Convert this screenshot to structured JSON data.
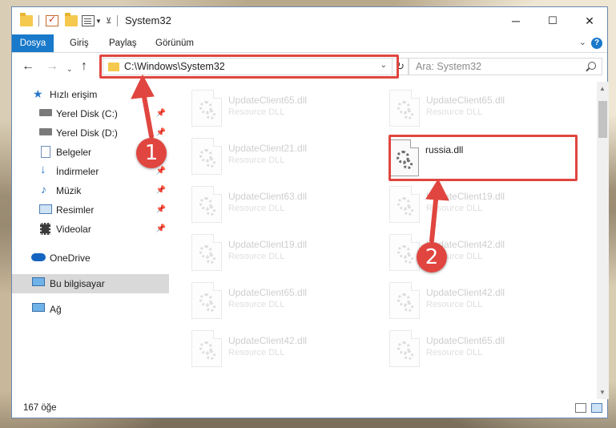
{
  "window": {
    "title": "System32",
    "controls": {
      "minimize": "─",
      "maximize": "☐",
      "close": "✕"
    }
  },
  "ribbon": {
    "tabs": [
      "Dosya",
      "Giriş",
      "Paylaş",
      "Görünüm"
    ],
    "help": "?"
  },
  "navbar": {
    "address": "C:\\Windows\\System32",
    "search_placeholder": "Ara: System32"
  },
  "sidebar": {
    "items": [
      {
        "label": "Hızlı erişim",
        "icon": "star-icon",
        "pinned": false
      },
      {
        "label": "Yerel Disk (C:)",
        "icon": "drive-icon",
        "pinned": true
      },
      {
        "label": "Yerel Disk (D:)",
        "icon": "drive-icon",
        "pinned": true
      },
      {
        "label": "Belgeler",
        "icon": "documents-icon",
        "pinned": true
      },
      {
        "label": "İndirmeler",
        "icon": "download-icon",
        "pinned": true
      },
      {
        "label": "Müzik",
        "icon": "music-icon",
        "pinned": true
      },
      {
        "label": "Resimler",
        "icon": "pictures-icon",
        "pinned": true
      },
      {
        "label": "Videolar",
        "icon": "videos-icon",
        "pinned": true
      },
      {
        "label": "OneDrive",
        "icon": "cloud-icon",
        "pinned": false
      },
      {
        "label": "Bu bilgisayar",
        "icon": "computer-icon",
        "pinned": false,
        "selected": true
      },
      {
        "label": "Ağ",
        "icon": "network-icon",
        "pinned": false
      }
    ]
  },
  "files": [
    {
      "name": "UpdateClient65.dll",
      "type": "Resource DLL",
      "faded": true
    },
    {
      "name": "UpdateClient65.dll",
      "type": "Resource DLL",
      "faded": true
    },
    {
      "name": "UpdateClient21.dll",
      "type": "Resource DLL",
      "faded": true
    },
    {
      "name": "russia.dll",
      "type": "",
      "faded": false
    },
    {
      "name": "UpdateClient63.dll",
      "type": "Resource DLL",
      "faded": true
    },
    {
      "name": "UpdateClient19.dll",
      "type": "Resource DLL",
      "faded": true
    },
    {
      "name": "UpdateClient19.dll",
      "type": "Resource DLL",
      "faded": true
    },
    {
      "name": "UpdateClient42.dll",
      "type": "Resource DLL",
      "faded": true
    },
    {
      "name": "UpdateClient65.dll",
      "type": "Resource DLL",
      "faded": true
    },
    {
      "name": "UpdateClient42.dll",
      "type": "Resource DLL",
      "faded": true
    },
    {
      "name": "UpdateClient42.dll",
      "type": "Resource DLL",
      "faded": true
    },
    {
      "name": "UpdateClient65.dll",
      "type": "Resource DLL",
      "faded": true
    }
  ],
  "status": {
    "count": "167 öğe"
  },
  "annotations": {
    "badge1": "1",
    "badge2": "2",
    "color": "#e0463f"
  },
  "colors": {
    "accent": "#1979ca",
    "highlight": "#e0463f",
    "selected": "#d9d9d9"
  }
}
